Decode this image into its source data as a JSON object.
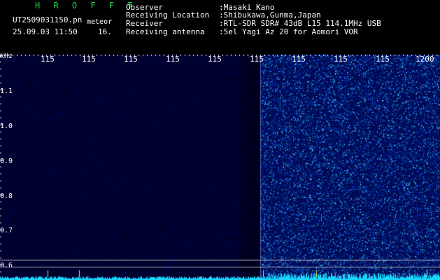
{
  "header": {
    "station_code": "H R O F F T",
    "filename": "UT2509031150.pn",
    "type_label": "meteor",
    "date_time": "25.09.03 11:50",
    "count": "16.",
    "fields": [
      {
        "label": "Observer",
        "value": ":Masaki Kano"
      },
      {
        "label": "Receiving Location",
        "value": ":Shibukawa,Gunma,Japan"
      },
      {
        "label": "Receiver",
        "value": ":RTL-SDR SDR# 43dB L15 114.1MHz USB"
      },
      {
        "label": "Receiving antenna",
        "value": ":5el Yagi Az 20 for Aomori VOR"
      }
    ]
  },
  "axes": {
    "y_unit": "kHz",
    "y_ticks": [
      "1.1",
      "1.0",
      "0.9",
      "0.8",
      "0.7",
      "0.6"
    ],
    "x_ticks": [
      "115",
      "115",
      "115",
      "115",
      "115",
      "115",
      "115",
      "115",
      "115",
      "1200"
    ]
  },
  "colors": {
    "background": "#000000",
    "spectrogram_dark": "#00003a",
    "spectrogram_bright": "#0a2aa0",
    "noise_cyan": "#19d6ff",
    "title_green": "#1fd24a"
  }
}
